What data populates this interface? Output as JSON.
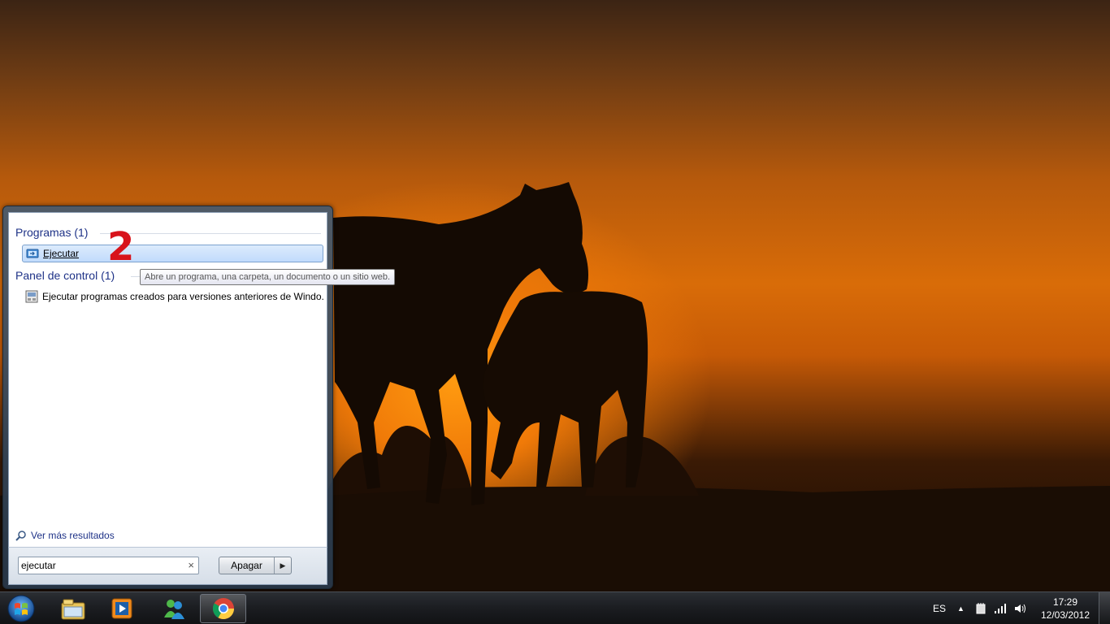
{
  "start_menu": {
    "groups": [
      {
        "title": "Programas (1)",
        "items": [
          {
            "label": "Ejecutar",
            "icon": "run-icon",
            "selected": true
          }
        ]
      },
      {
        "title": "Panel de control (1)",
        "items": [
          {
            "label": "Ejecutar programas creados para versiones anteriores de Windo...",
            "icon": "compatibility-icon",
            "selected": false
          }
        ]
      }
    ],
    "more_results": "Ver más resultados",
    "search": {
      "value": "ejecutar"
    },
    "shutdown_label": "Apagar"
  },
  "annotation": {
    "step_number": "2"
  },
  "tooltip": "Abre un programa, una carpeta, un documento o un sitio web.",
  "taskbar": {
    "pinned": [
      "windows-explorer-icon",
      "media-player-icon",
      "messenger-icon",
      "chrome-icon"
    ],
    "active_app": "chrome-icon",
    "language": "ES",
    "clock": {
      "time": "17:29",
      "date": "12/03/2012"
    }
  },
  "colors": {
    "group_title": "#1e3287",
    "annotation": "#d8131b"
  }
}
